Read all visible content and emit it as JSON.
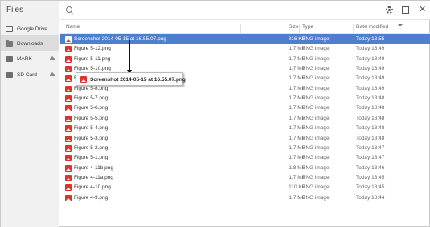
{
  "sidebar": {
    "title": "Files",
    "items": [
      {
        "label": "Google Drive",
        "icon": "drive-icon"
      },
      {
        "label": "Downloads",
        "icon": "folder-icon",
        "active": true
      },
      {
        "label": "MARK",
        "icon": "usb-drive-icon",
        "eject": true
      },
      {
        "label": "SD Card",
        "icon": "sd-card-icon",
        "eject": true
      }
    ]
  },
  "toolbar": {
    "search_icon": "search-icon",
    "settings_icon": "gear-icon",
    "maximize_icon": "maximize-icon",
    "close_label": "✕"
  },
  "columns": {
    "name": "Name",
    "size": "Size",
    "type": "Type",
    "date": "Date modified"
  },
  "files": [
    {
      "name": "Screenshot 2014-05-15 at 16.55.07.png",
      "size": "816 KB",
      "type": "PNG image",
      "date": "Today 13:55",
      "selected": true
    },
    {
      "name": "Figure 5-12.png",
      "size": "1.7 MB",
      "type": "PNG image",
      "date": "Today 13:49"
    },
    {
      "name": "Figure 5-11.png",
      "size": "1.7 MB",
      "type": "PNG image",
      "date": "Today 13:49"
    },
    {
      "name": "Figure 5-10.png",
      "size": "1.7 MB",
      "type": "PNG image",
      "date": "Today 13:49"
    },
    {
      "name": "Figure 5-9.png",
      "size": "1.7 MB",
      "type": "PNG image",
      "date": "Today 13:49"
    },
    {
      "name": "Figure 5-8.png",
      "size": "1.7 MB",
      "type": "PNG image",
      "date": "Today 13:49"
    },
    {
      "name": "Figure 5-7.png",
      "size": "1.7 MB",
      "type": "PNG image",
      "date": "Today 13:48"
    },
    {
      "name": "Figure 5-6.png",
      "size": "1.7 MB",
      "type": "PNG image",
      "date": "Today 13:48"
    },
    {
      "name": "Figure 5-5.png",
      "size": "1.7 MB",
      "type": "PNG image",
      "date": "Today 13:48"
    },
    {
      "name": "Figure 5-4.png",
      "size": "1.7 MB",
      "type": "PNG image",
      "date": "Today 13:48"
    },
    {
      "name": "Figure 5-3.png",
      "size": "1.7 MB",
      "type": "PNG image",
      "date": "Today 13:48"
    },
    {
      "name": "Figure 5-2.png",
      "size": "1.7 MB",
      "type": "PNG image",
      "date": "Today 13:47"
    },
    {
      "name": "Figure 5-1.png",
      "size": "1.7 MB",
      "type": "PNG image",
      "date": "Today 13:47"
    },
    {
      "name": "Figure 4-11b.png",
      "size": "1.8 MB",
      "type": "PNG image",
      "date": "Today 13:46"
    },
    {
      "name": "Figure 4-11a.png",
      "size": "1.7 MB",
      "type": "PNG image",
      "date": "Today 13:45"
    },
    {
      "name": "Figure 4-10.png",
      "size": "110 KB",
      "type": "PNG image",
      "date": "Today 13:45"
    },
    {
      "name": "Figure 4-9.png",
      "size": "1.7 MB",
      "type": "PNG image",
      "date": "Today 13:44"
    }
  ],
  "drag": {
    "label": "Screenshot 2014-05-15 at 16.55.07.png"
  },
  "colors": {
    "selection": "#4d7fcf",
    "file_icon": "#d9362b",
    "sidebar_bg": "#f1f1f1"
  }
}
